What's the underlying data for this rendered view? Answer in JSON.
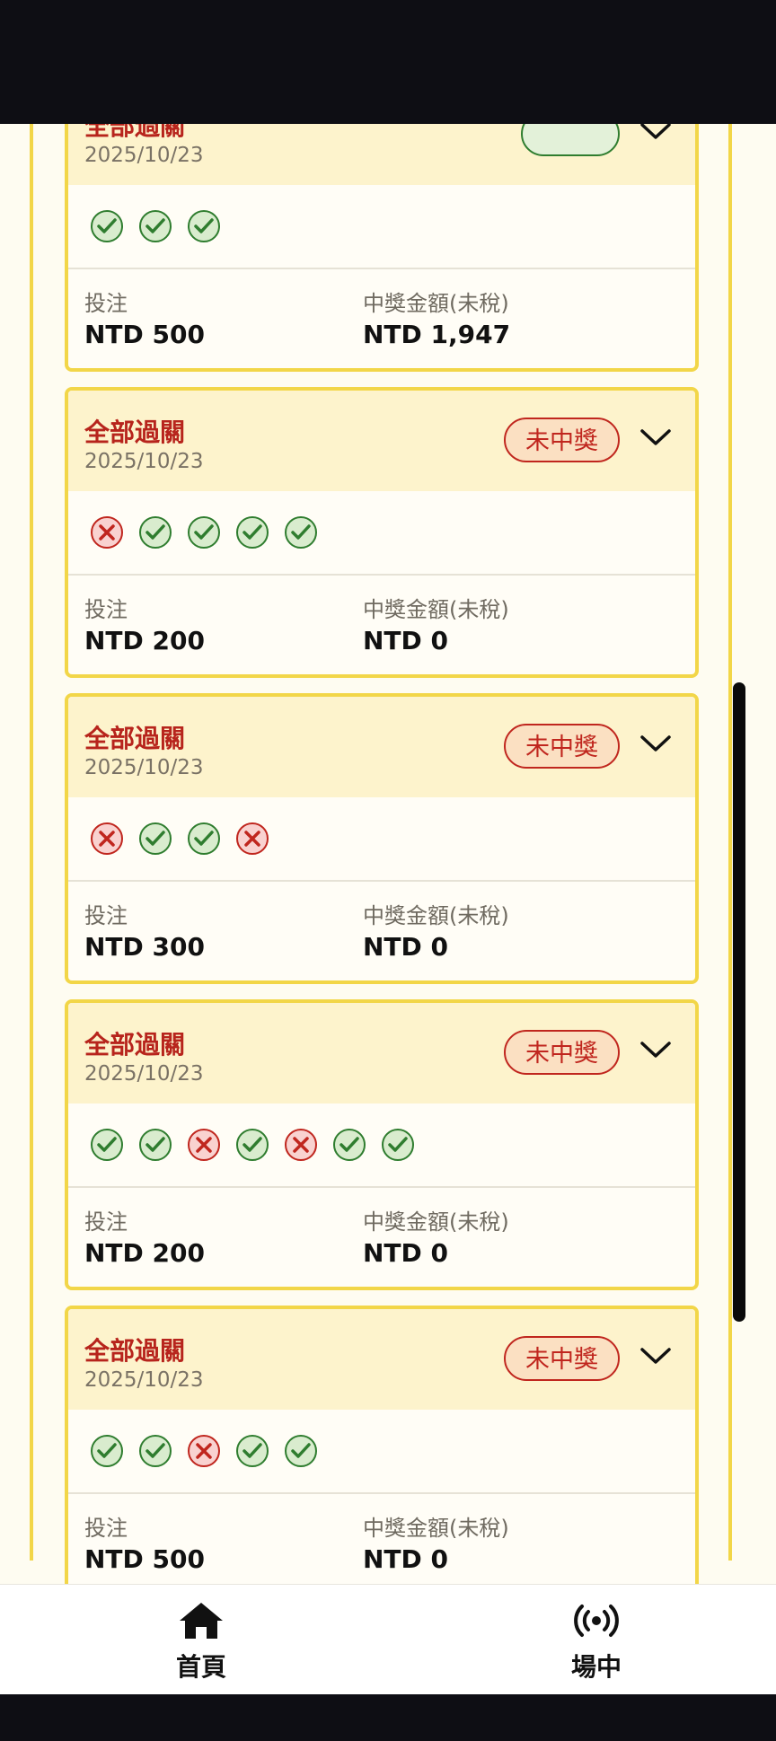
{
  "bets": [
    {
      "title": "全部過關",
      "date": "2025/10/23",
      "status": "",
      "legs": [
        "win",
        "win",
        "win"
      ],
      "stake_label": "投注",
      "stake": "NTD 500",
      "payout_label": "中獎金額(未稅)",
      "payout": "NTD 1,947"
    },
    {
      "title": "全部過關",
      "date": "2025/10/23",
      "status": "未中獎",
      "legs": [
        "loss",
        "win",
        "win",
        "win",
        "win"
      ],
      "stake_label": "投注",
      "stake": "NTD 200",
      "payout_label": "中獎金額(未稅)",
      "payout": "NTD 0"
    },
    {
      "title": "全部過關",
      "date": "2025/10/23",
      "status": "未中獎",
      "legs": [
        "loss",
        "win",
        "win",
        "loss"
      ],
      "stake_label": "投注",
      "stake": "NTD 300",
      "payout_label": "中獎金額(未稅)",
      "payout": "NTD 0"
    },
    {
      "title": "全部過關",
      "date": "2025/10/23",
      "status": "未中獎",
      "legs": [
        "win",
        "win",
        "loss",
        "win",
        "loss",
        "win",
        "win"
      ],
      "stake_label": "投注",
      "stake": "NTD 200",
      "payout_label": "中獎金額(未稅)",
      "payout": "NTD 0"
    },
    {
      "title": "全部過關",
      "date": "2025/10/23",
      "status": "未中獎",
      "legs": [
        "win",
        "win",
        "loss",
        "win",
        "win"
      ],
      "stake_label": "投注",
      "stake": "NTD 500",
      "payout_label": "中獎金額(未稅)",
      "payout": "NTD 0"
    }
  ],
  "nav": {
    "home_label": "首頁",
    "home_icon": "home-icon",
    "live_label": "場中",
    "live_icon": "broadcast-icon"
  },
  "colors": {
    "accent_border": "#f2d648",
    "header_bg": "#fdf3cc",
    "title_red": "#b7241c",
    "win_green": "#2f7d2f",
    "loss_red": "#c0261e"
  }
}
